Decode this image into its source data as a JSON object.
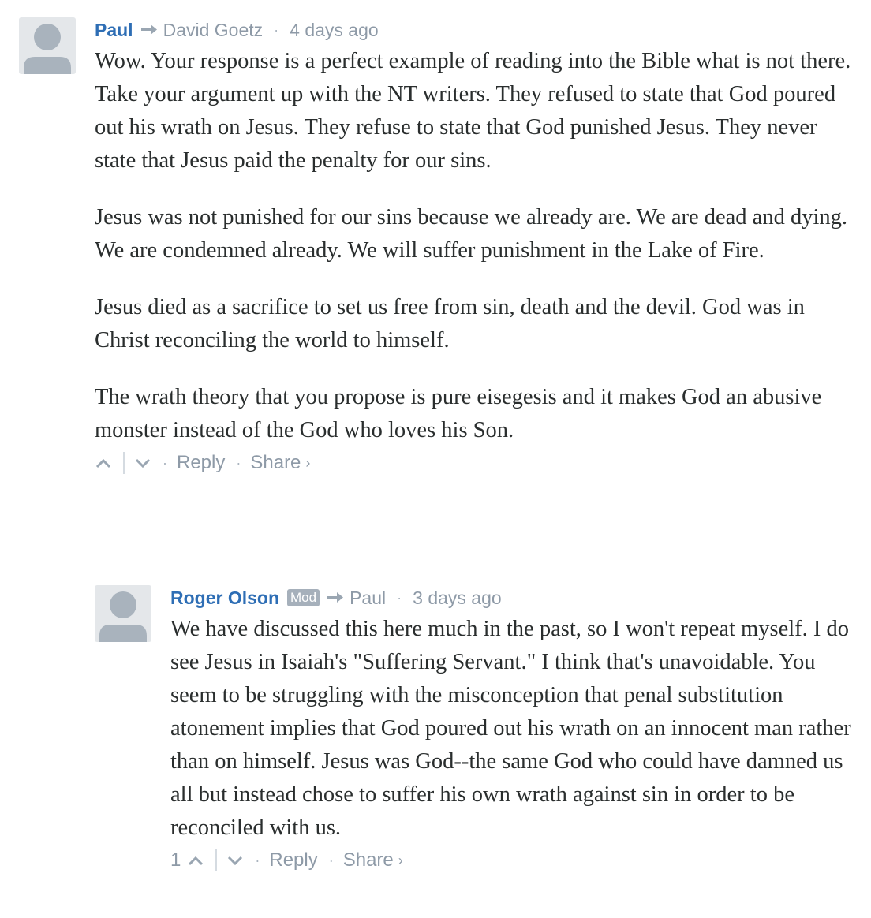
{
  "comments": [
    {
      "author": "Paul",
      "badge": "",
      "reply_to": "David Goetz",
      "time": "4 days ago",
      "paragraphs": [
        "Wow. Your response is a perfect example of reading into the Bible what is not there. Take your argument up with the NT writers. They refused to state that God poured out his wrath on Jesus. They refuse to state that God punished Jesus. They never state that Jesus paid the penalty for our sins.",
        "Jesus was not punished for our sins because we already are. We are dead and dying. We are condemned already. We will suffer punishment in the Lake of Fire.",
        "Jesus died as a sacrifice to set us free from sin, death and the devil. God was in Christ reconciling the world to himself.",
        "The wrath theory that you propose is pure eisegesis and it makes God an abusive monster instead of the God who loves his Son."
      ],
      "upvotes": "",
      "reply_label": "Reply",
      "share_label": "Share",
      "share_chevron": "›"
    },
    {
      "author": "Roger Olson",
      "badge": "Mod",
      "reply_to": "Paul",
      "time": "3 days ago",
      "paragraphs": [
        "We have discussed this here much in the past, so I won't repeat myself. I do see Jesus in Isaiah's \"Suffering Servant.\" I think that's unavoidable. You seem to be struggling with the misconception that penal substitution atonement implies that God poured out his wrath on an innocent man rather than on himself. Jesus was God--the same God who could have damned us all but instead chose to suffer his own wrath against sin in order to be reconciled with us."
      ],
      "upvotes": "1",
      "reply_label": "Reply",
      "share_label": "Share",
      "share_chevron": "›"
    }
  ],
  "icons": {
    "avatar": "avatar-placeholder-icon",
    "reply_to": "reply-arrow-icon",
    "upvote": "upvote-icon",
    "downvote": "downvote-icon"
  },
  "colors": {
    "author": "#2e6eb5",
    "meta": "#8e9aa7",
    "text": "#2a2e2e",
    "badge_bg": "#a6b0bb",
    "avatar_bg": "#e4e7ea",
    "avatar_fg": "#a9b3bd"
  }
}
